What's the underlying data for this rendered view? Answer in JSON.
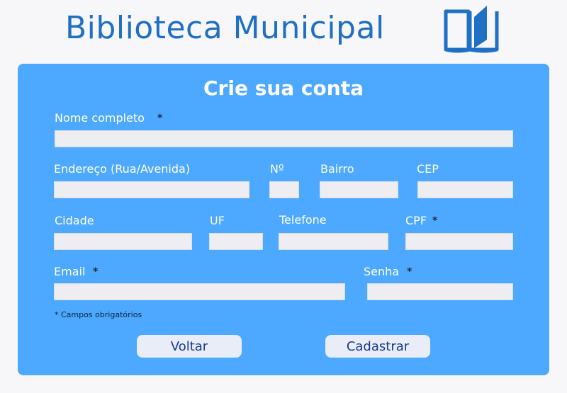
{
  "header": {
    "title": "Biblioteca Municipal",
    "logo_icon": "open-book-icon",
    "brand_color": "#1f6fc4"
  },
  "form": {
    "title": "Crie sua conta",
    "required_marker": "*",
    "fields": {
      "nome": {
        "label": "Nome completo",
        "value": "",
        "required": true
      },
      "endereco": {
        "label": "Endereço (Rua/Avenida)",
        "value": ""
      },
      "numero": {
        "label": "Nº",
        "value": ""
      },
      "bairro": {
        "label": "Bairro",
        "value": ""
      },
      "cep": {
        "label": "CEP",
        "value": ""
      },
      "cidade": {
        "label": "Cidade",
        "value": ""
      },
      "uf": {
        "label": "UF",
        "value": ""
      },
      "telefone": {
        "label": "Telefone",
        "value": ""
      },
      "cpf": {
        "label": "CPF",
        "value": "",
        "required": true
      },
      "email": {
        "label": "Email",
        "value": "",
        "required": true
      },
      "senha": {
        "label": "Senha",
        "value": "",
        "required": true
      }
    },
    "required_note": "* Campos obrigatórios",
    "buttons": {
      "back": "Voltar",
      "submit": "Cadastrar"
    }
  },
  "colors": {
    "card_background": "#4da9ff",
    "page_background": "#f7f7f9",
    "field_background": "#eeeef2",
    "button_background": "#e8edf8",
    "button_text": "#173a8a"
  }
}
